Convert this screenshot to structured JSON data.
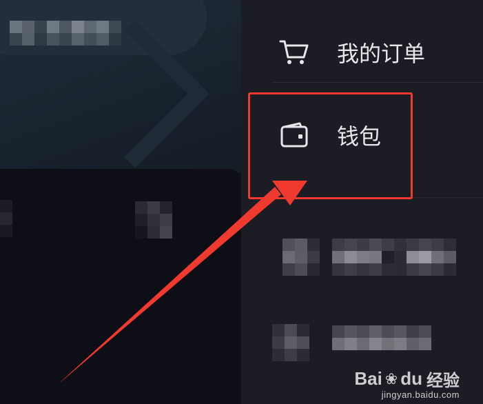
{
  "menu": {
    "orders": {
      "label": "我的订单",
      "icon": "cart-icon"
    },
    "wallet": {
      "label": "钱包",
      "icon": "wallet-icon"
    }
  },
  "annotation": {
    "box_color": "#f13a2f",
    "arrow_color": "#f13a2f"
  },
  "watermark": {
    "brand_left": "Bai",
    "brand_right": "du",
    "brand_cn": "经验",
    "url": "jingyan.baidu.com"
  },
  "colors": {
    "right_panel": "#1c1d24",
    "left_top": "#1a2530",
    "left_bottom": "#0d0e16",
    "text": "#e8e8ec"
  }
}
